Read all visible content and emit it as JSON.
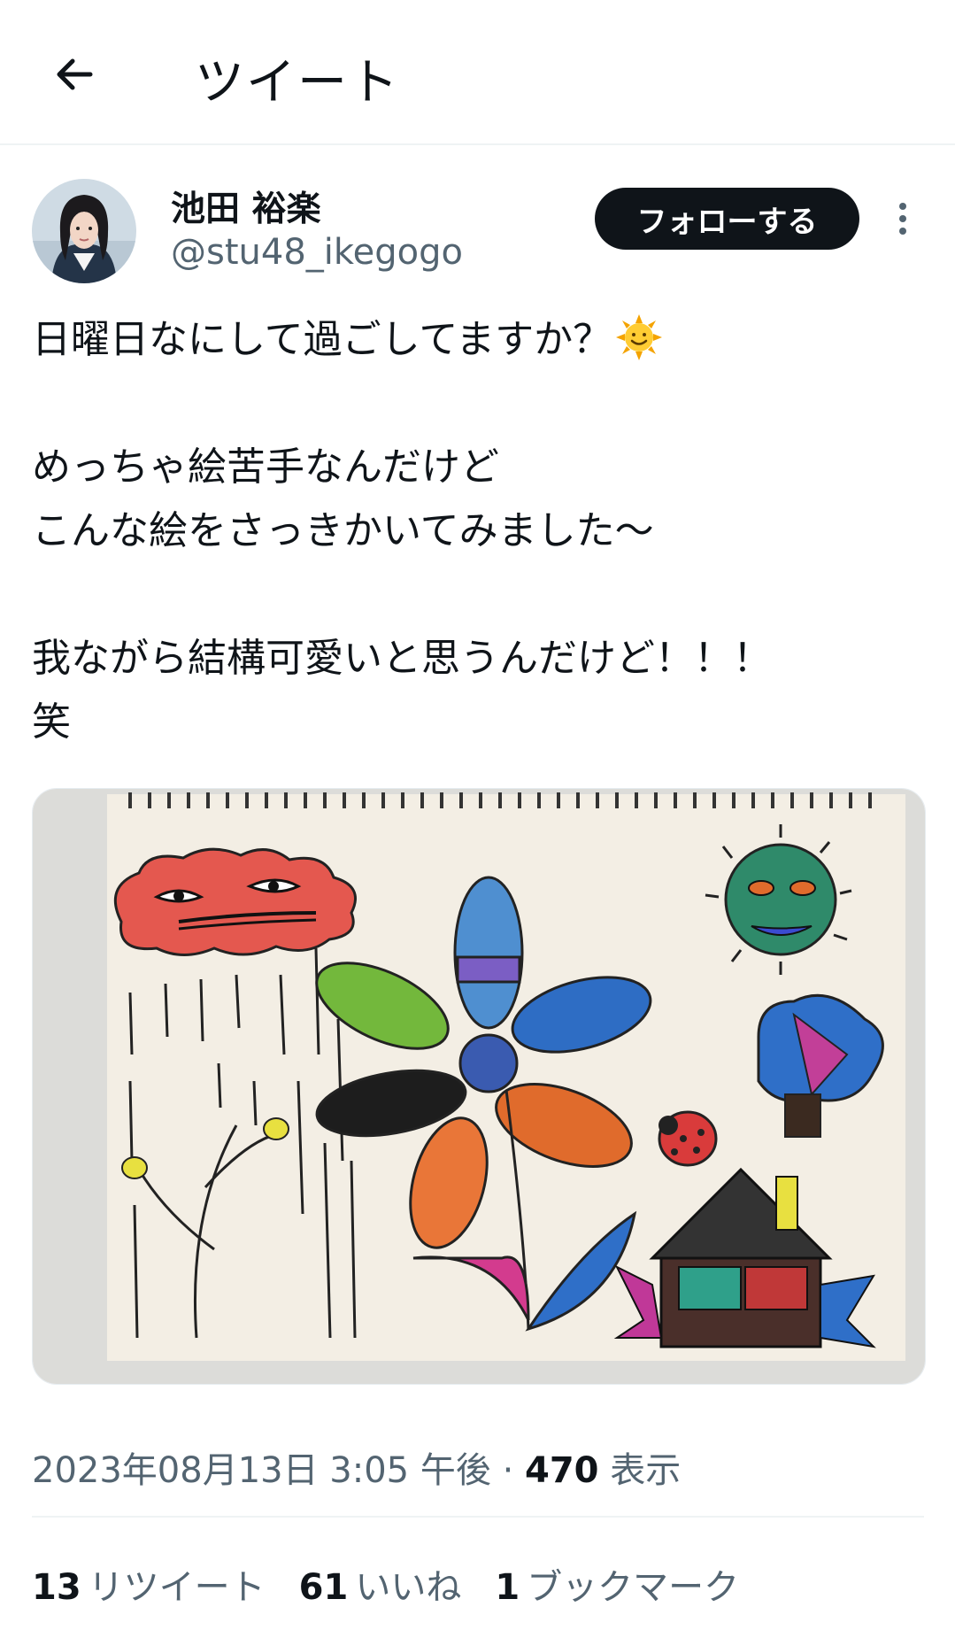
{
  "header": {
    "title": "ツイート",
    "back_icon": "arrow-left-icon"
  },
  "author": {
    "name": "池田 裕楽",
    "handle": "@stu48_ikegogo",
    "follow_label": "フォローする",
    "more_icon": "more-vertical-icon"
  },
  "tweet": {
    "lines": [
      "日曜日なにして過ごしてますか？",
      "",
      "めっちゃ絵苦手なんだけど",
      "こんな絵をさっきかいてみました〜",
      "",
      "我ながら結構可愛いと思うんだけど！！！",
      "笑"
    ],
    "emoji": "sun-with-face-emoji"
  },
  "meta": {
    "datetime": "2023年08月13日 3:05 午後",
    "separator": "·",
    "views_count": "470",
    "views_label": "表示"
  },
  "stats": {
    "retweets_count": "13",
    "retweets_label": "リツイート",
    "likes_count": "61",
    "likes_label": "いいね",
    "bookmarks_count": "1",
    "bookmarks_label": "ブックマーク"
  },
  "colors": {
    "text": "#0f1419",
    "secondary": "#536471",
    "button_bg": "#0f1419",
    "divider": "#eff3f4"
  }
}
